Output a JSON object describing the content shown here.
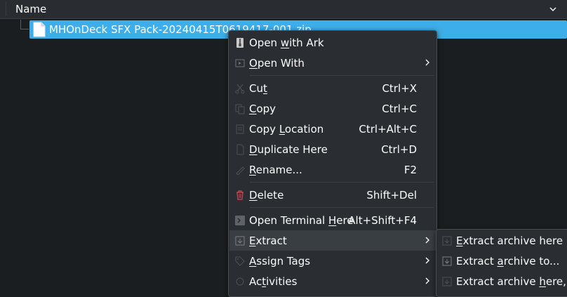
{
  "header": {
    "column_title": "Name"
  },
  "file": {
    "name": "MHOnDeck SFX Pack-20240415T0619417-001.zip"
  },
  "context_menu": {
    "open_with_ark": {
      "pre": "Open ",
      "u": "w",
      "post": "ith Ark",
      "icon": "ark-icon"
    },
    "open_with": {
      "pre": "",
      "u": "O",
      "post": "pen With",
      "icon": "open-with-icon"
    },
    "cut": {
      "pre": "Cu",
      "u": "t",
      "post": "",
      "shortcut": "Ctrl+X",
      "icon": "cut-icon"
    },
    "copy": {
      "pre": "",
      "u": "C",
      "post": "opy",
      "shortcut": "Ctrl+C",
      "icon": "copy-icon"
    },
    "copy_location": {
      "pre": "Copy ",
      "u": "L",
      "post": "ocation",
      "shortcut": "Ctrl+Alt+C",
      "icon": "copy-location-icon"
    },
    "duplicate_here": {
      "pre": "",
      "u": "D",
      "post": "uplicate Here",
      "shortcut": "Ctrl+D",
      "icon": "duplicate-icon"
    },
    "rename": {
      "pre": "",
      "u": "R",
      "post": "ename...",
      "shortcut": "F2",
      "icon": "rename-icon"
    },
    "delete": {
      "pre": "",
      "u": "D",
      "post": "elete",
      "shortcut": "Shift+Del",
      "icon": "trash-icon",
      "icon_color": "#da4453"
    },
    "open_terminal": {
      "pre": "Open Terminal ",
      "u": "H",
      "post": "ere",
      "shortcut": "Alt+Shift+F4",
      "icon": "terminal-icon"
    },
    "extract": {
      "pre": "",
      "u": "E",
      "post": "xtract",
      "icon": "extract-icon"
    },
    "assign_tags": {
      "pre": "",
      "u": "A",
      "post": "ssign Tags",
      "icon": "tag-icon"
    },
    "activities": {
      "pre": "Ac",
      "u": "t",
      "post": "ivities",
      "icon": "activities-icon"
    }
  },
  "submenu": {
    "extract_here": {
      "pre": "",
      "u": "E",
      "post": "xtract archive here",
      "icon": "extract-here-icon"
    },
    "extract_to": {
      "pre": "Extract ",
      "u": "a",
      "post": "rchive to...",
      "icon": "extract-to-icon"
    },
    "extract_autodetect": {
      "pre": "Extract archive ",
      "u": "h",
      "post": "ere, au",
      "icon": "extract-autodetect-icon"
    }
  },
  "colors": {
    "selection": "#3daee9",
    "menu_bg": "#2a2e32",
    "highlight": "#393e43",
    "delete_icon": "#da4453"
  }
}
